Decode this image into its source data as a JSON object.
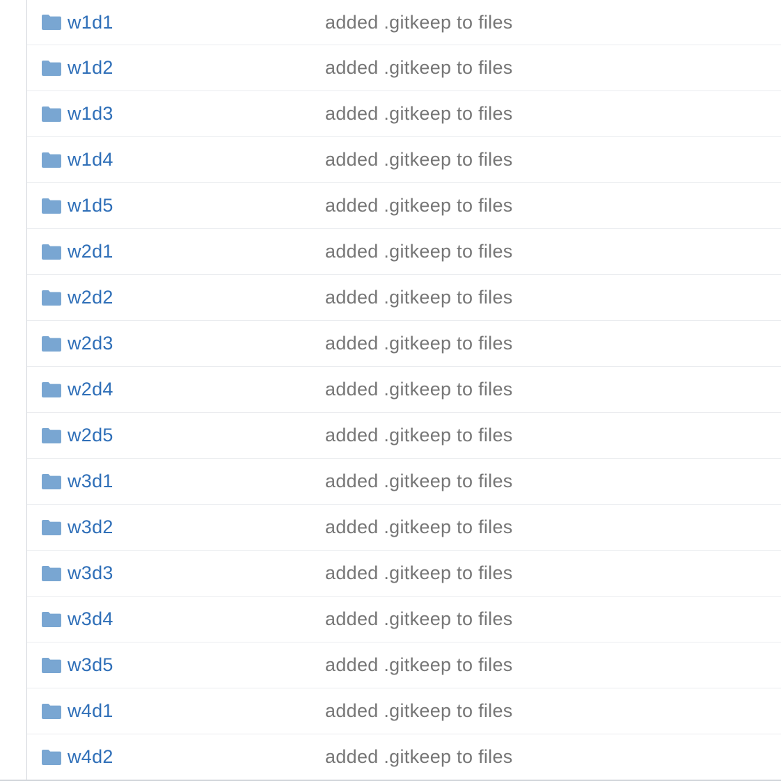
{
  "colors": {
    "link": "#2f6fb8",
    "message": "#767676",
    "folder_icon": "#79a6d2",
    "row_border": "#eaecef"
  },
  "file_list": {
    "rows": [
      {
        "icon": "folder-icon",
        "name": "w1d1",
        "message": "added .gitkeep to files"
      },
      {
        "icon": "folder-icon",
        "name": "w1d2",
        "message": "added .gitkeep to files"
      },
      {
        "icon": "folder-icon",
        "name": "w1d3",
        "message": "added .gitkeep to files"
      },
      {
        "icon": "folder-icon",
        "name": "w1d4",
        "message": "added .gitkeep to files"
      },
      {
        "icon": "folder-icon",
        "name": "w1d5",
        "message": "added .gitkeep to files"
      },
      {
        "icon": "folder-icon",
        "name": "w2d1",
        "message": "added .gitkeep to files"
      },
      {
        "icon": "folder-icon",
        "name": "w2d2",
        "message": "added .gitkeep to files"
      },
      {
        "icon": "folder-icon",
        "name": "w2d3",
        "message": "added .gitkeep to files"
      },
      {
        "icon": "folder-icon",
        "name": "w2d4",
        "message": "added .gitkeep to files"
      },
      {
        "icon": "folder-icon",
        "name": "w2d5",
        "message": "added .gitkeep to files"
      },
      {
        "icon": "folder-icon",
        "name": "w3d1",
        "message": "added .gitkeep to files"
      },
      {
        "icon": "folder-icon",
        "name": "w3d2",
        "message": "added .gitkeep to files"
      },
      {
        "icon": "folder-icon",
        "name": "w3d3",
        "message": "added .gitkeep to files"
      },
      {
        "icon": "folder-icon",
        "name": "w3d4",
        "message": "added .gitkeep to files"
      },
      {
        "icon": "folder-icon",
        "name": "w3d5",
        "message": "added .gitkeep to files"
      },
      {
        "icon": "folder-icon",
        "name": "w4d1",
        "message": "added .gitkeep to files"
      },
      {
        "icon": "folder-icon",
        "name": "w4d2",
        "message": "added .gitkeep to files"
      }
    ]
  }
}
